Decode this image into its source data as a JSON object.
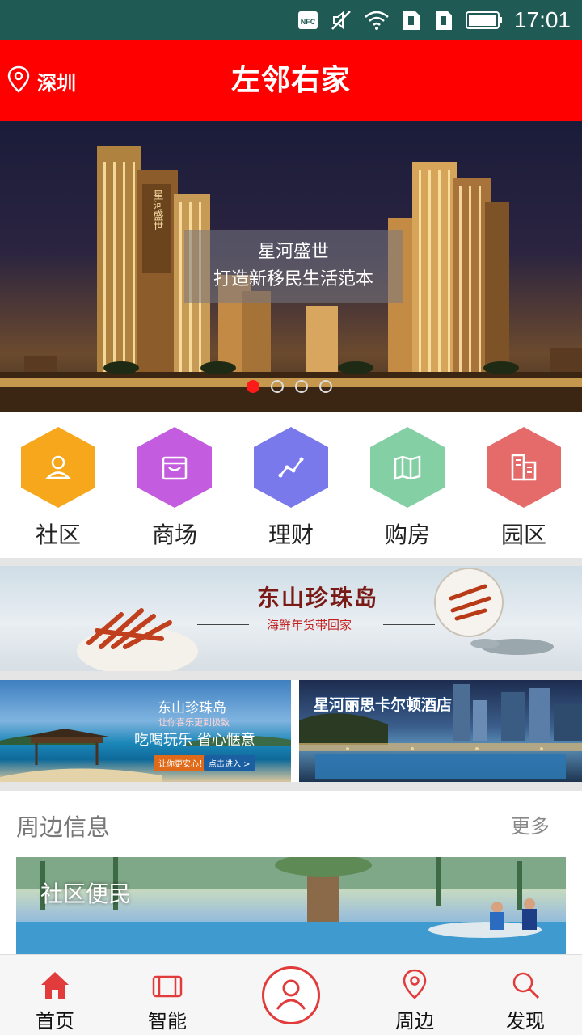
{
  "status_bar": {
    "time": "17:01",
    "icons": [
      "nfc-icon",
      "mute-icon",
      "wifi-icon",
      "sim1-icon",
      "sim2-icon",
      "battery-icon"
    ],
    "nfc_label": "NFC"
  },
  "header": {
    "location": "深圳",
    "title": "左邻右家",
    "color": "#ff0000"
  },
  "hero": {
    "caption_line1": "星河盛世",
    "caption_line2": "打造新移民生活范本",
    "building_sign": "星河盛世",
    "slides": 4,
    "active_slide": 1
  },
  "categories": [
    {
      "label": "社区",
      "icon": "user-icon",
      "color": "#f7a71b"
    },
    {
      "label": "商场",
      "icon": "bag-icon",
      "color": "#c45ce0"
    },
    {
      "label": "理财",
      "icon": "trend-icon",
      "color": "#7a79ec"
    },
    {
      "label": "购房",
      "icon": "map-icon",
      "color": "#84cfa4"
    },
    {
      "label": "园区",
      "icon": "building-icon",
      "color": "#e56a6a"
    }
  ],
  "banner": {
    "title": "东山珍珠岛",
    "subtitle": "海鲜年货带回家"
  },
  "promos": [
    {
      "title": "东山珍珠岛",
      "subtitle": "让你喜乐更到极致",
      "slogan": "吃喝玩乐 省心惬意",
      "button1": "让你更安心！",
      "button2": "点击进入 >"
    },
    {
      "title": "星河丽思卡尔顿酒店"
    }
  ],
  "nearby": {
    "title": "周边信息",
    "more": "更多",
    "card_label": "社区便民"
  },
  "tabbar": {
    "items": [
      {
        "label": "首页",
        "icon": "home-icon",
        "active": true
      },
      {
        "label": "智能",
        "icon": "device-icon",
        "active": false
      },
      {
        "label": "",
        "icon": "profile-icon",
        "active": false
      },
      {
        "label": "周边",
        "icon": "location-icon",
        "active": false
      },
      {
        "label": "发现",
        "icon": "search-icon",
        "active": false
      }
    ],
    "accent": "#e23b3b"
  }
}
